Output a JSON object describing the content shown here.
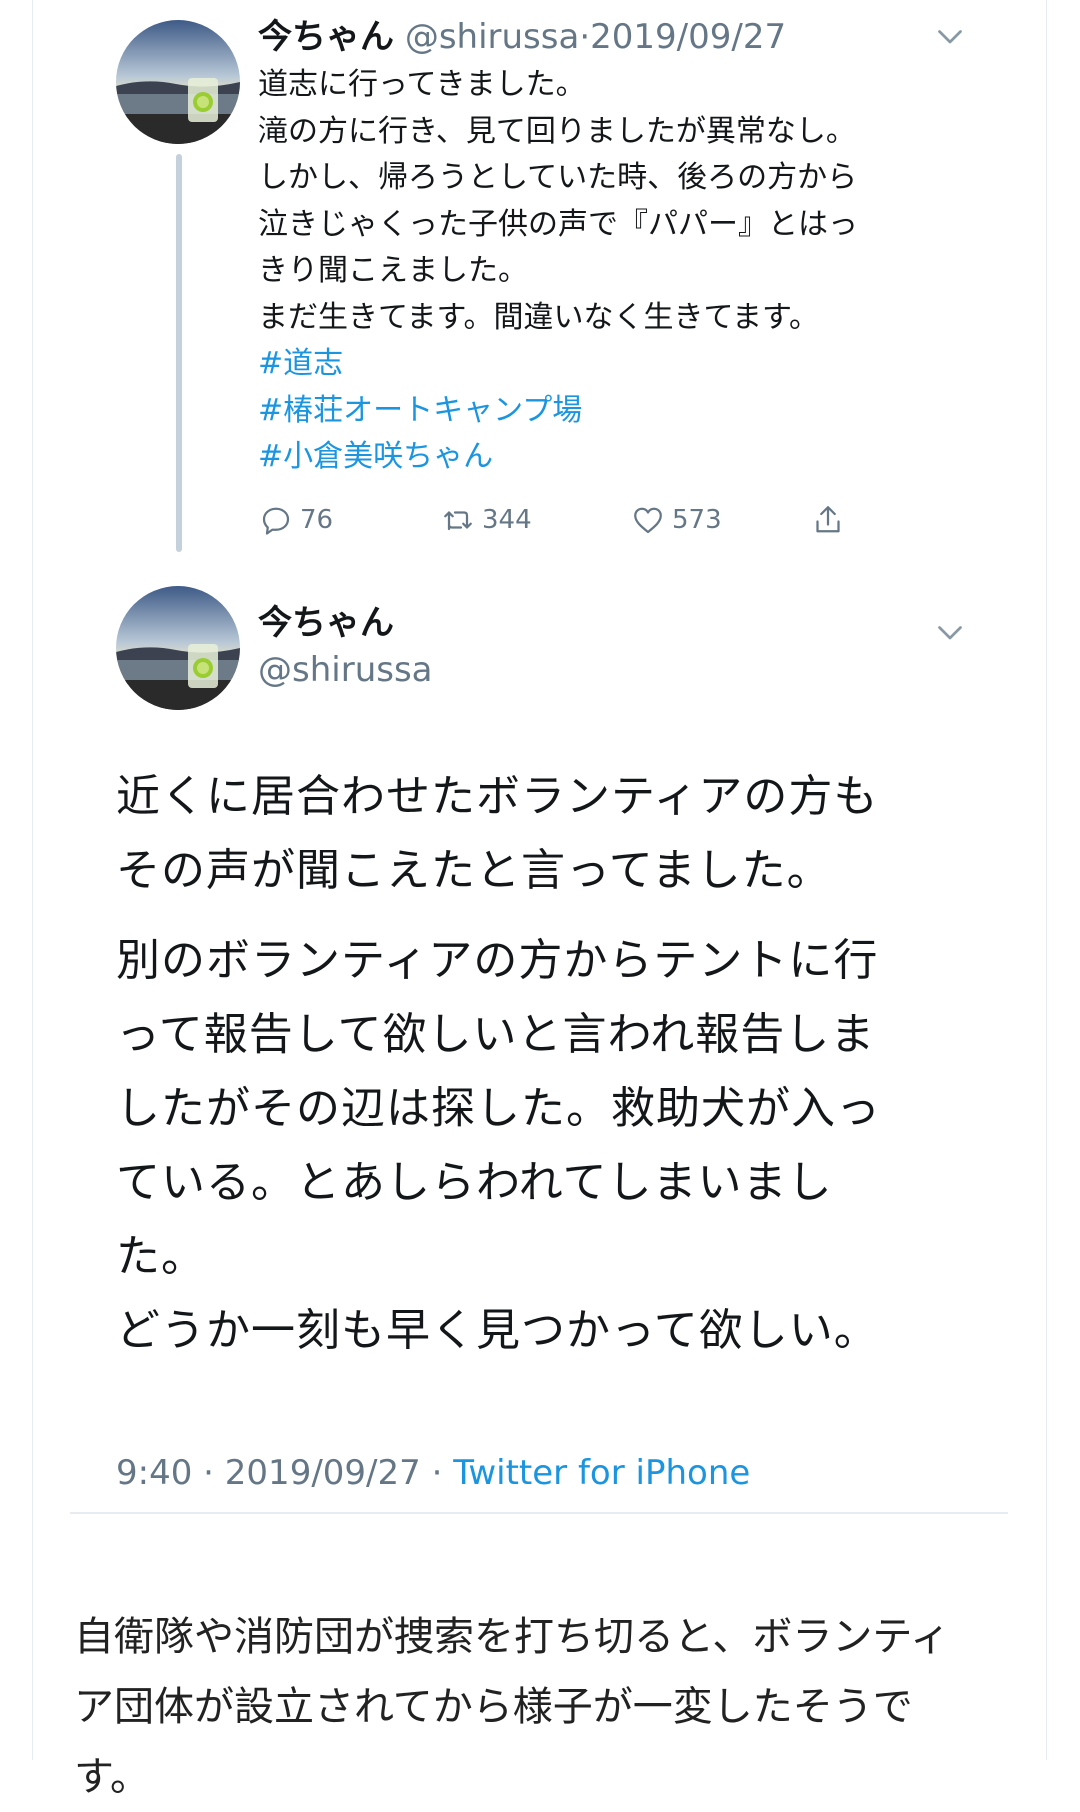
{
  "tweet1": {
    "name": "今ちゃん",
    "handle": "@shirussa",
    "separator": "·",
    "date": "2019/09/27",
    "lines": [
      "道志に行ってきました。",
      "滝の方に行き、見て回りましたが異常なし。",
      "しかし、帰ろうとしていた時、後ろの方から",
      "泣きじゃくった子供の声で『パパー』とはっ",
      "きり聞こえました。",
      "まだ生きてます。間違いなく生きてます。"
    ],
    "hashtags": [
      "#道志",
      "#椿荘オートキャンプ場",
      "#小倉美咲ちゃん"
    ],
    "reply_count": "76",
    "retweet_count": "344",
    "like_count": "573"
  },
  "tweet2": {
    "name": "今ちゃん",
    "handle": "@shirussa",
    "paragraph1": [
      "近くに居合わせたボランティアの方も",
      "その声が聞こえたと言ってました。"
    ],
    "paragraph2": [
      "別のボランティアの方からテントに行",
      "って報告して欲しいと言われ報告しま",
      "したがその辺は探した。救助犬が入っ",
      "ている。とあしらわれてしまいまし",
      "た。",
      "どうか一刻も早く見つかって欲しい。"
    ],
    "time": "9:40",
    "separator": "·",
    "date": "2019/09/27",
    "source": "Twitter for iPhone"
  },
  "article": {
    "lines": [
      "自衛隊や消防団が捜索を打ち切ると、ボランティ",
      "ア団体が設立されてから様子が一変したそうで",
      "す。"
    ]
  },
  "icons": [
    "avatar",
    "chevron-down-icon",
    "reply-icon",
    "retweet-icon",
    "like-icon",
    "share-icon"
  ],
  "colors": {
    "link": "#1b95e0",
    "muted": "#657786",
    "thread_line": "#c4d1dc"
  }
}
